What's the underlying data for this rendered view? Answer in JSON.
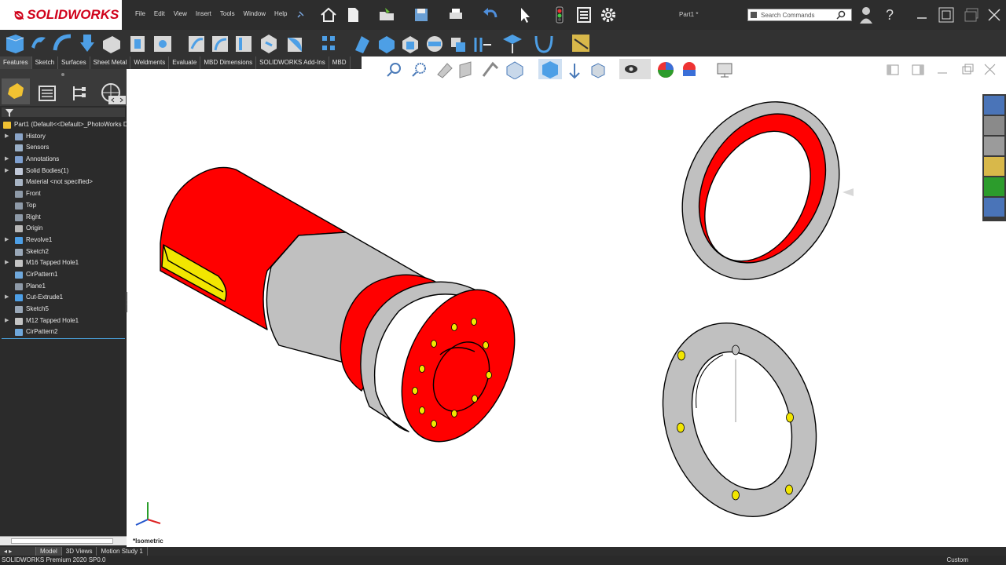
{
  "app": {
    "brand": "SOLIDWORKS",
    "document_title": "Part1 *",
    "menus": [
      "File",
      "Edit",
      "View",
      "Insert",
      "Tools",
      "Window",
      "Help"
    ],
    "search_placeholder": "Search Commands"
  },
  "command_tabs": [
    "Features",
    "Sketch",
    "Surfaces",
    "Sheet Metal",
    "Weldments",
    "Evaluate",
    "MBD Dimensions",
    "SOLIDWORKS Add-Ins",
    "MBD"
  ],
  "active_command_tab": "Features",
  "feature_tree": {
    "root": "Part1  (Default<<Default>_PhotoWorks D",
    "items": [
      {
        "label": "History",
        "icon": "history-icon",
        "expandable": true
      },
      {
        "label": "Sensors",
        "icon": "sensor-icon",
        "expandable": false
      },
      {
        "label": "Annotations",
        "icon": "annotations-icon",
        "expandable": true
      },
      {
        "label": "Solid Bodies(1)",
        "icon": "solid-bodies-icon",
        "expandable": true
      },
      {
        "label": "Material <not specified>",
        "icon": "material-icon",
        "expandable": false
      },
      {
        "label": "Front",
        "icon": "plane-icon",
        "expandable": false
      },
      {
        "label": "Top",
        "icon": "plane-icon",
        "expandable": false
      },
      {
        "label": "Right",
        "icon": "plane-icon",
        "expandable": false
      },
      {
        "label": "Origin",
        "icon": "origin-icon",
        "expandable": false
      },
      {
        "label": "Revolve1",
        "icon": "revolve-icon",
        "expandable": true
      },
      {
        "label": "Sketch2",
        "icon": "sketch-icon",
        "expandable": false
      },
      {
        "label": "M16 Tapped Hole1",
        "icon": "hole-icon",
        "expandable": true
      },
      {
        "label": "CirPattern1",
        "icon": "circular-pattern-icon",
        "expandable": false
      },
      {
        "label": "Plane1",
        "icon": "plane-icon",
        "expandable": false
      },
      {
        "label": "Cut-Extrude1",
        "icon": "cut-extrude-icon",
        "expandable": true
      },
      {
        "label": "Sketch5",
        "icon": "sketch-icon",
        "expandable": false
      },
      {
        "label": "M12 Tapped Hole1",
        "icon": "hole-icon",
        "expandable": true
      },
      {
        "label": "CirPattern2",
        "icon": "circular-pattern-icon",
        "expandable": false
      }
    ]
  },
  "viewport": {
    "view_label": "*Isometric"
  },
  "bottom_tabs": [
    "Model",
    "3D Views",
    "Motion Study 1"
  ],
  "active_bottom_tab": "Model",
  "status": {
    "version": "SOLIDWORKS Premium 2020 SP0.0",
    "units": "Custom"
  },
  "colors": {
    "accent_red": "#ff0000",
    "part_gray": "#c0c0c0",
    "hole_yellow": "#f2e600",
    "ui_dark": "#2d2d2d",
    "rollback_blue": "#4aa3df"
  }
}
